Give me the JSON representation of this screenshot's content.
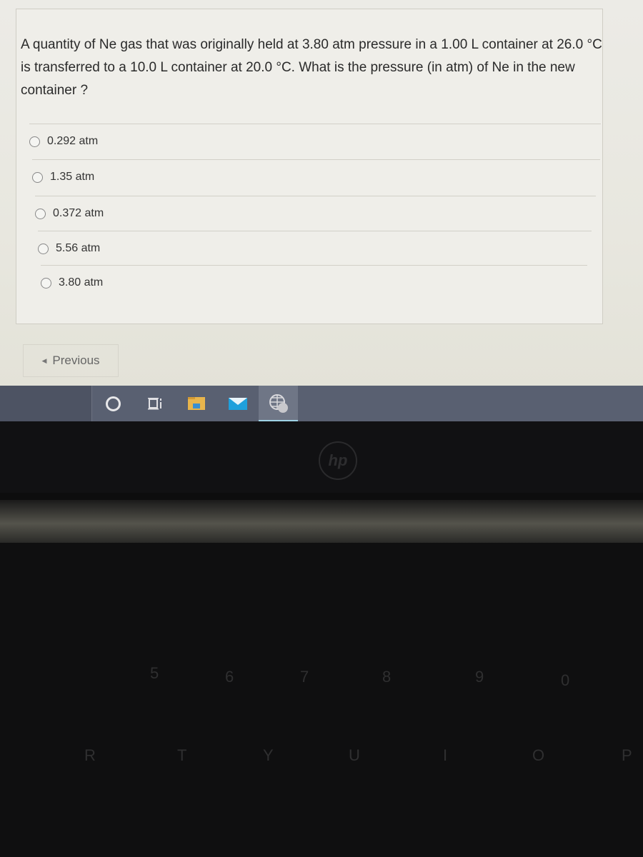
{
  "question": {
    "text": "A quantity of Ne gas that was originally held at 3.80 atm pressure in a 1.00 L container at 26.0 °C is transferred to a 10.0 L container at 20.0 °C. What is the pressure (in atm) of Ne in the new container ?"
  },
  "options": [
    {
      "label": "0.292 atm",
      "selected": false
    },
    {
      "label": "1.35 atm",
      "selected": false
    },
    {
      "label": "0.372 atm",
      "selected": false
    },
    {
      "label": "5.56 atm",
      "selected": false
    },
    {
      "label": "3.80 atm",
      "selected": false
    }
  ],
  "navigation": {
    "previous_label": "Previous"
  },
  "taskbar": {
    "icons": [
      "cortana-search-icon",
      "task-view-icon",
      "file-explorer-icon",
      "mail-icon",
      "browser-globe-icon"
    ],
    "active": "browser-globe-icon"
  },
  "laptop": {
    "logo": "hp",
    "keys": [
      "5",
      "6",
      "7",
      "8",
      "9",
      "0",
      "R",
      "T",
      "Y",
      "U",
      "I",
      "O",
      "P"
    ]
  },
  "colors": {
    "taskbar": "#596071",
    "active_indicator": "#9fd3e6",
    "mail": "#1ea0dc",
    "folder": "#e8b54c"
  }
}
